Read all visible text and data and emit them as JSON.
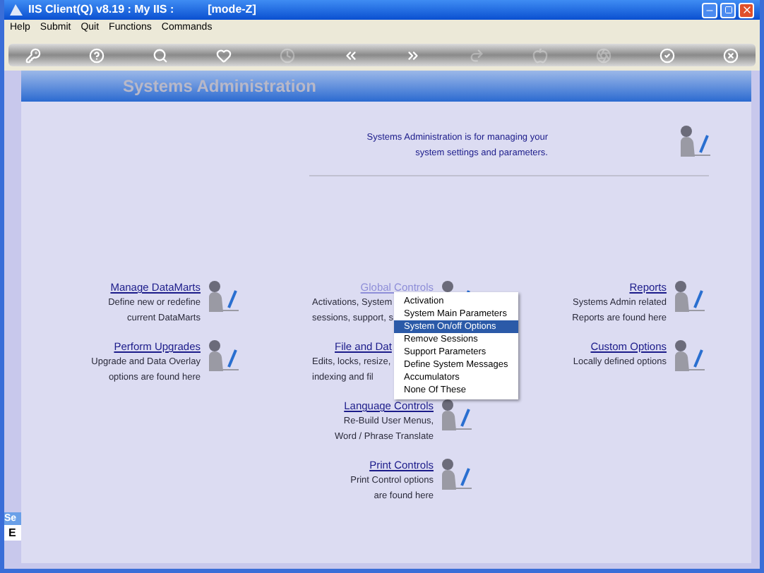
{
  "window": {
    "title": "IIS Client(Q) v8.19 : My IIS :",
    "mode": "[mode-Z]"
  },
  "menu": [
    "Help",
    "Submit",
    "Quit",
    "Functions",
    "Commands"
  ],
  "toolbar": [
    {
      "kind": "key",
      "disabled": false
    },
    {
      "kind": "help",
      "disabled": false
    },
    {
      "kind": "search",
      "disabled": false
    },
    {
      "kind": "heart",
      "disabled": false
    },
    {
      "kind": "clock",
      "disabled": true
    },
    {
      "kind": "back",
      "disabled": false
    },
    {
      "kind": "forward",
      "disabled": false
    },
    {
      "kind": "bracket",
      "disabled": true
    },
    {
      "kind": "apple",
      "disabled": true
    },
    {
      "kind": "gear",
      "disabled": true
    },
    {
      "kind": "ok",
      "disabled": false
    },
    {
      "kind": "close",
      "disabled": false
    }
  ],
  "page": {
    "title": "Systems Administration",
    "intro": [
      "Systems Administration is for managing your",
      "system settings and parameters."
    ]
  },
  "columns": [
    [
      {
        "kind": "full",
        "title": "Manage DataMarts",
        "lines": [
          "Define new or redefine",
          "current DataMarts"
        ]
      },
      {
        "kind": "full",
        "title": "Perform Upgrades",
        "lines": [
          "Upgrade and Data Overlay",
          "options are found here"
        ]
      }
    ],
    [
      {
        "kind": "lines_covered",
        "title": "Global Controls",
        "lines": [
          "Activations, System",
          "sessions, support, s"
        ]
      },
      {
        "kind": "covered",
        "title": "File and Dat",
        "lines": [
          "Edits, locks, resize,",
          "indexing and fil"
        ]
      },
      {
        "kind": "full",
        "title": "Language Controls",
        "lines": [
          "Re-Build User Menus,",
          "Word / Phrase Translate"
        ]
      },
      {
        "kind": "full",
        "title": "Print Controls",
        "lines": [
          "Print Control options",
          "are found here"
        ]
      }
    ],
    [
      {
        "kind": "full",
        "title": "Reports",
        "lines": [
          "Systems Admin related",
          "Reports are found here"
        ]
      },
      {
        "kind": "full",
        "title": "Custom Options",
        "lines": [
          "Locally defined options"
        ]
      }
    ]
  ],
  "popup_menu": [
    {
      "label": "Activation",
      "selected": false
    },
    {
      "label": "System Main Parameters",
      "selected": false
    },
    {
      "label": "System On/off Options",
      "selected": true
    },
    {
      "label": "Remove Sessions",
      "selected": false
    },
    {
      "label": "Support Parameters",
      "selected": false
    },
    {
      "label": "Define System Messages",
      "selected": false
    },
    {
      "label": "Accumulators",
      "selected": false
    },
    {
      "label": "None Of These",
      "selected": false
    }
  ],
  "background_window": {
    "tab": "Se",
    "label": "E"
  }
}
